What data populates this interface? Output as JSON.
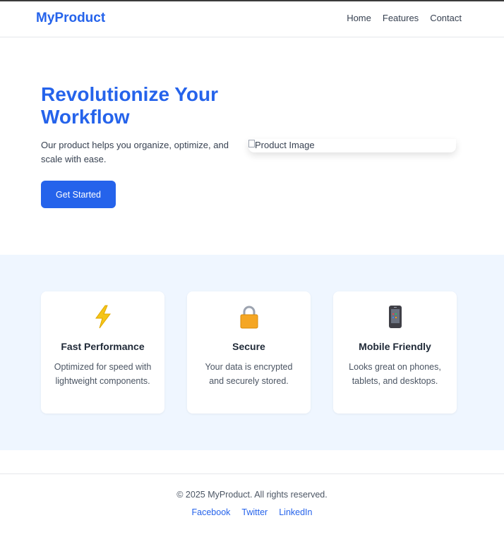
{
  "header": {
    "logo": "MyProduct",
    "nav": [
      "Home",
      "Features",
      "Contact"
    ]
  },
  "hero": {
    "title": "Revolutionize Your Workflow",
    "text": "Our product helps you organize, optimize, and scale with ease.",
    "cta_label": "Get Started",
    "image_alt": "Product Image"
  },
  "features": [
    {
      "icon": "lightning-icon",
      "title": "Fast Performance",
      "text": "Optimized for speed with lightweight components."
    },
    {
      "icon": "lock-icon",
      "title": "Secure",
      "text": "Your data is encrypted and securely stored."
    },
    {
      "icon": "mobile-phone-icon",
      "title": "Mobile Friendly",
      "text": "Looks great on phones, tablets, and desktops."
    }
  ],
  "footer": {
    "copyright": "© 2025 MyProduct. All rights reserved.",
    "links": [
      "Facebook",
      "Twitter",
      "LinkedIn"
    ]
  },
  "colors": {
    "brand": "#2563eb",
    "features_bg": "#eff6ff"
  }
}
